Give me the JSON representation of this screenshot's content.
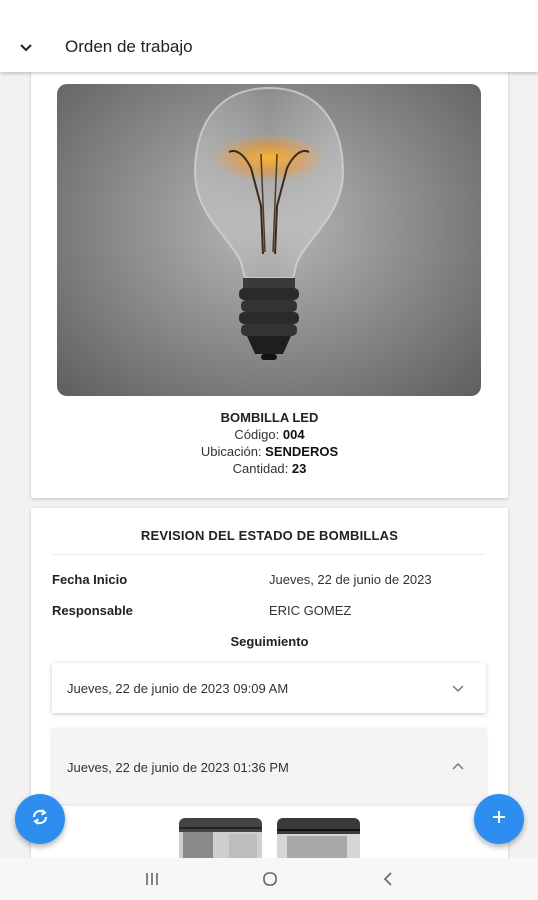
{
  "appbar": {
    "title": "Orden de trabajo",
    "back_icon": "chevron-down-icon"
  },
  "item": {
    "name": "BOMBILLA LED",
    "code_label": "Código:",
    "code_value": "004",
    "location_label": "Ubicación:",
    "location_value": "SENDEROS",
    "quantity_label": "Cantidad:",
    "quantity_value": "23"
  },
  "review": {
    "title": "REVISION DEL ESTADO DE BOMBILLAS",
    "start_label": "Fecha Inicio",
    "start_value": "Jueves, 22 de junio de 2023",
    "responsible_label": "Responsable",
    "responsible_value": "ERIC GOMEZ",
    "tracking_title": "Seguimiento",
    "entries": [
      {
        "label": "Jueves, 22 de junio de 2023 09:09 AM",
        "expanded": false
      },
      {
        "label": "Jueves, 22 de junio de 2023 01:36 PM",
        "expanded": true
      }
    ]
  },
  "fabs": {
    "sync_icon": "sync-icon",
    "add_icon": "plus-icon"
  },
  "colors": {
    "accent": "#2d8ef0",
    "bulb_glow": "#f5b830"
  }
}
